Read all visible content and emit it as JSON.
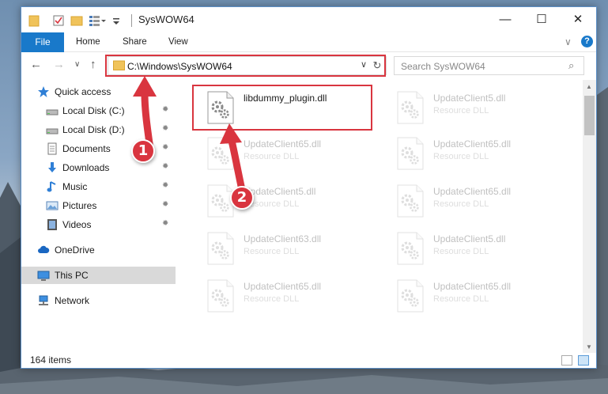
{
  "window": {
    "title": "SysWOW64",
    "minimize_glyph": "—",
    "maximize_glyph": "☐",
    "close_glyph": "✕"
  },
  "ribbon": {
    "file": "File",
    "home": "Home",
    "share": "Share",
    "view": "View",
    "expand_glyph": "∨",
    "help_glyph": "?"
  },
  "nav": {
    "back_glyph": "←",
    "forward_glyph": "→",
    "recent_glyph": "∨",
    "up_glyph": "↑",
    "address": "C:\\Windows\\SysWOW64",
    "address_chevron": "∨",
    "refresh_glyph": "↻",
    "search_placeholder": "Search SysWOW64",
    "search_glyph": "⌕"
  },
  "sidebar": {
    "pin_glyph": "✹",
    "items": [
      {
        "label": "Quick access",
        "icon": "star-icon"
      },
      {
        "label": "Local Disk (C:)",
        "icon": "drive-icon"
      },
      {
        "label": "Local Disk (D:)",
        "icon": "drive-icon"
      },
      {
        "label": "Documents",
        "icon": "documents-icon"
      },
      {
        "label": "Downloads",
        "icon": "download-icon"
      },
      {
        "label": "Music",
        "icon": "music-icon"
      },
      {
        "label": "Pictures",
        "icon": "pictures-icon"
      },
      {
        "label": "Videos",
        "icon": "videos-icon"
      },
      {
        "label": "OneDrive",
        "icon": "cloud-icon"
      },
      {
        "label": "This PC",
        "icon": "computer-icon"
      },
      {
        "label": "Network",
        "icon": "network-icon"
      }
    ]
  },
  "files": [
    {
      "name": "libdummy_plugin.dll",
      "type": ""
    },
    {
      "name": "UpdateClient5.dll",
      "type": "Resource DLL"
    },
    {
      "name": "UpdateClient65.dll",
      "type": "Resource DLL"
    },
    {
      "name": "UpdateClient65.dll",
      "type": "Resource DLL"
    },
    {
      "name": "UpdateClient5.dll",
      "type": "Resource DLL"
    },
    {
      "name": "UpdateClient65.dll",
      "type": "Resource DLL"
    },
    {
      "name": "UpdateClient63.dll",
      "type": "Resource DLL"
    },
    {
      "name": "UpdateClient5.dll",
      "type": "Resource DLL"
    },
    {
      "name": "UpdateClient65.dll",
      "type": "Resource DLL"
    },
    {
      "name": "UpdateClient65.dll",
      "type": "Resource DLL"
    }
  ],
  "status": {
    "item_count": "164 items"
  },
  "callouts": {
    "one": "1",
    "two": "2"
  },
  "colors": {
    "accent": "#1979ca",
    "highlight": "#d9353f",
    "selected": "#d9d9d9"
  }
}
